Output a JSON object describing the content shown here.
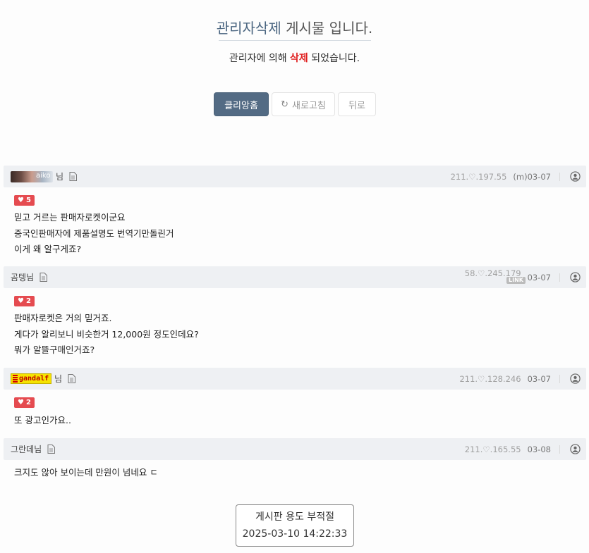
{
  "notice": {
    "title_accent": "관리자삭제",
    "title_rest": " 게시물 입니다.",
    "sub_prefix": "관리자에 의해 ",
    "sub_deleted": "삭제",
    "sub_suffix": " 되었습니다."
  },
  "buttons": {
    "home": "클리앙홈",
    "refresh": "새로고침",
    "back": "뒤로"
  },
  "comments": [
    {
      "nick_image_text": "aiko",
      "nick_suffix": "님",
      "ip": "211.♡.197.55",
      "date": "(m)03-07",
      "likes": "5",
      "body": "믿고 거르는 판매자로켓이군요\n중국인판매자에 제품설명도 번역기만돌린거\n이게 왜 알구게죠?"
    },
    {
      "nick": "곰텡님",
      "ip": "58.♡.245.179",
      "link_badge": "LINK",
      "date": "03-07",
      "likes": "2",
      "body": "판매자로켓은 거의 믿거죠.\n게다가 알리보니 비슷한거 12,000원 정도인데요?\n뭐가 알뜰구매인거죠?"
    },
    {
      "nick_image_text": "gandalf",
      "nick_suffix": "님",
      "ip": "211.♡.128.246",
      "date": "03-07",
      "likes": "2",
      "body": "또 광고인가요.."
    },
    {
      "nick": "그란데님",
      "ip": "211.♡.165.55",
      "date": "03-08",
      "body": "크지도 않아 보이는데 만원이 넘네요 ㄷ"
    }
  ],
  "stamp": {
    "line1": "게시판 용도 부적절",
    "line2": "2025-03-10 14:22:33"
  },
  "colors": {
    "primary_button": "#536b84",
    "deleted_red": "#e02020",
    "like_badge": "#e54b50",
    "comment_header_bg": "#eef0f3"
  },
  "icons": {
    "refresh": "refresh-icon",
    "document": "document-icon",
    "user": "user-circle-icon",
    "heart": "heart-icon"
  }
}
